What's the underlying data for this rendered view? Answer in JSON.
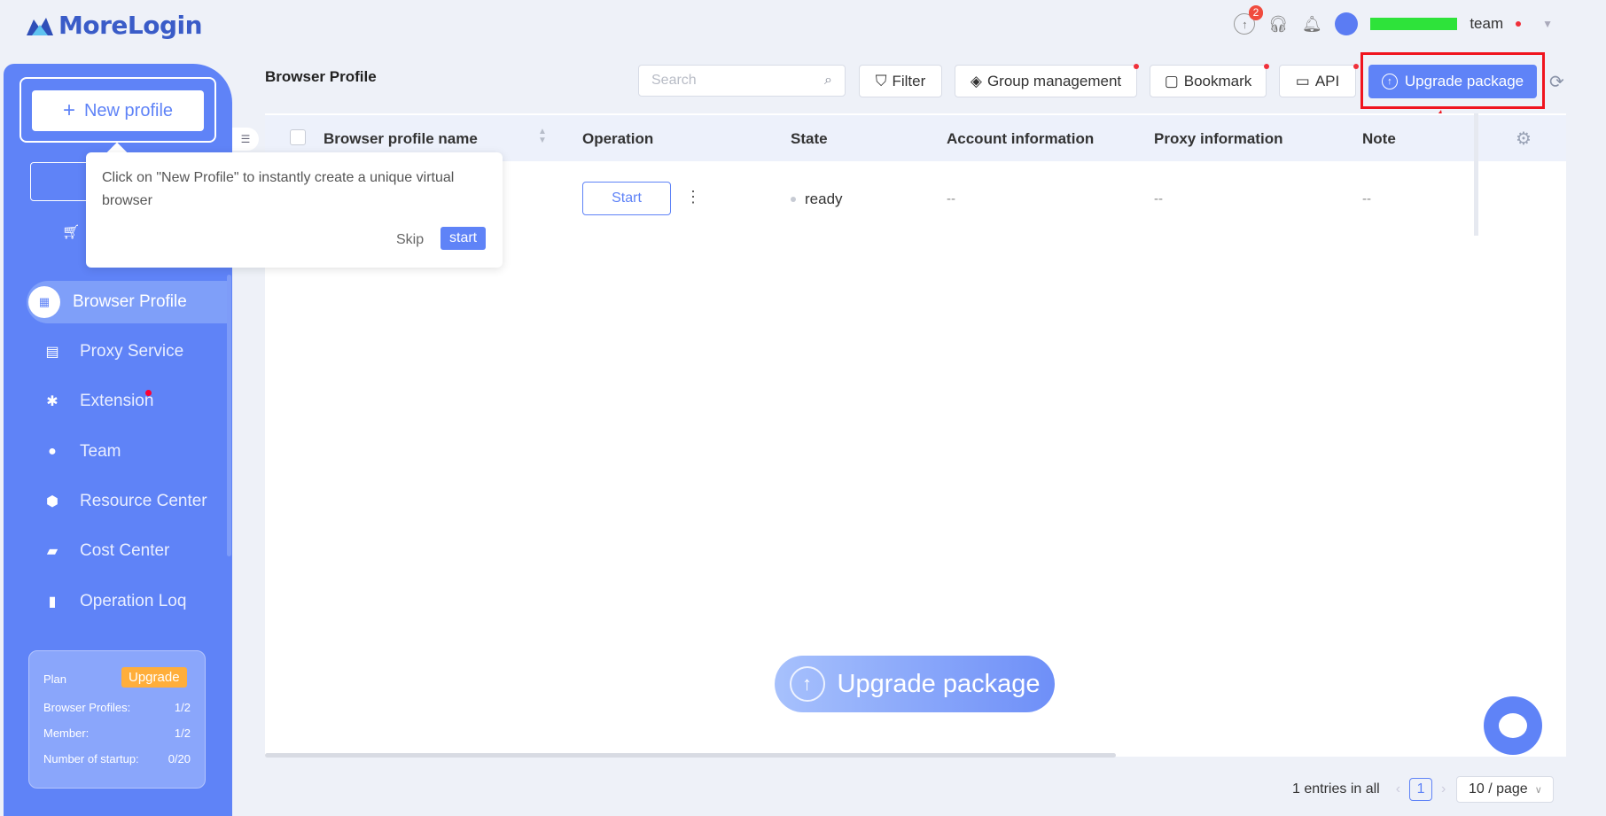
{
  "app": {
    "name": "MoreLogin"
  },
  "header": {
    "notification_count": "2",
    "team_label": "team"
  },
  "sidebar": {
    "new_profile": "New profile",
    "nav": [
      {
        "label": "Browser Profile",
        "icon": "profile-icon"
      },
      {
        "label": "Proxy Service",
        "icon": "server-icon"
      },
      {
        "label": "Extension",
        "icon": "puzzle-icon"
      },
      {
        "label": "Team",
        "icon": "team-icon"
      },
      {
        "label": "Resource Center",
        "icon": "cube-icon"
      },
      {
        "label": "Cost Center",
        "icon": "wallet-icon"
      },
      {
        "label": "Operation Loq",
        "icon": "log-icon"
      }
    ],
    "plan": {
      "title": "Plan",
      "upgrade": "Upgrade",
      "rows": [
        {
          "label": "Browser Profiles:",
          "value": "1/2"
        },
        {
          "label": "Member:",
          "value": "1/2"
        },
        {
          "label": "Number of startup:",
          "value": "0/20"
        }
      ]
    }
  },
  "toolbar": {
    "title": "Browser Profile",
    "search_placeholder": "Search",
    "filter": "Filter",
    "group_management": "Group management",
    "bookmark": "Bookmark",
    "api": "API",
    "upgrade_package": "Upgrade package"
  },
  "table": {
    "columns": [
      "Browser profile name",
      "Operation",
      "State",
      "Account information",
      "Proxy information",
      "Note"
    ],
    "rows": [
      {
        "operation_button": "Start",
        "state": "ready",
        "account": "--",
        "proxy": "--",
        "note": "--"
      }
    ]
  },
  "tooltip": {
    "text": "Click on \"New Profile\" to instantly create a unique virtual browser",
    "skip": "Skip",
    "start": "start"
  },
  "floating": {
    "upgrade_package": "Upgrade package"
  },
  "pagination": {
    "total": "1 entries in all",
    "current_page": "1",
    "page_size": "10 / page"
  },
  "colors": {
    "accent": "#5f83f7",
    "highlight": "#f0141e",
    "upgrade_orange": "#ffae3b"
  }
}
